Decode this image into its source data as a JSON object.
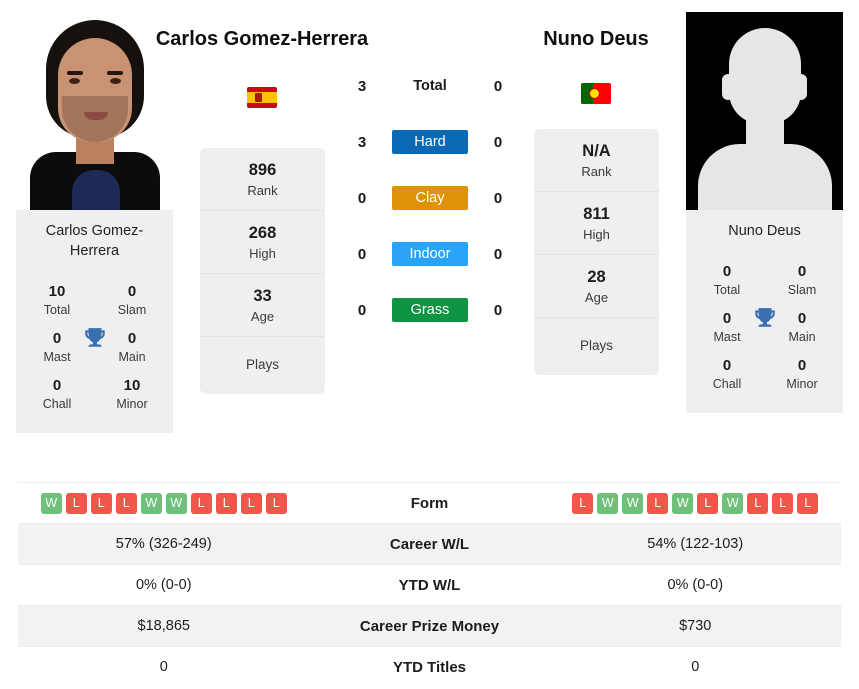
{
  "players": {
    "left": {
      "name": "Carlos Gomez-Herrera",
      "flag": "spain-flag",
      "photo": "player-headshot",
      "card_name": "Carlos Gomez-Herrera",
      "rank": "896",
      "rank_label": "Rank",
      "high": "268",
      "high_label": "High",
      "age": "33",
      "age_label": "Age",
      "plays_label": "Plays",
      "plays_value": "",
      "titles": {
        "total": "10",
        "total_label": "Total",
        "slam": "0",
        "slam_label": "Slam",
        "mast": "0",
        "mast_label": "Mast",
        "main": "0",
        "main_label": "Main",
        "chall": "0",
        "chall_label": "Chall",
        "minor": "10",
        "minor_label": "Minor"
      },
      "form": [
        "W",
        "L",
        "L",
        "L",
        "W",
        "W",
        "L",
        "L",
        "L",
        "L"
      ],
      "career_wl": "57% (326-249)",
      "ytd_wl": "0% (0-0)",
      "career_prize_money": "$18,865",
      "ytd_titles": "0"
    },
    "right": {
      "name": "Nuno Deus",
      "flag": "portugal-flag",
      "photo": "placeholder-avatar",
      "card_name": "Nuno Deus",
      "rank": "N/A",
      "rank_label": "Rank",
      "high": "811",
      "high_label": "High",
      "age": "28",
      "age_label": "Age",
      "plays_label": "Plays",
      "plays_value": "",
      "titles": {
        "total": "0",
        "total_label": "Total",
        "slam": "0",
        "slam_label": "Slam",
        "mast": "0",
        "mast_label": "Mast",
        "main": "0",
        "main_label": "Main",
        "chall": "0",
        "chall_label": "Chall",
        "minor": "0",
        "minor_label": "Minor"
      },
      "form": [
        "L",
        "W",
        "W",
        "L",
        "W",
        "L",
        "W",
        "L",
        "L",
        "L"
      ],
      "career_wl": "54% (122-103)",
      "ytd_wl": "0% (0-0)",
      "career_prize_money": "$730",
      "ytd_titles": "0"
    }
  },
  "head_to_head": [
    {
      "label": "Total",
      "left": "3",
      "right": "0",
      "color": ""
    },
    {
      "label": "Hard",
      "left": "3",
      "right": "0",
      "color": "#0b69b4"
    },
    {
      "label": "Clay",
      "left": "0",
      "right": "0",
      "color": "#dd9303"
    },
    {
      "label": "Indoor",
      "left": "0",
      "right": "0",
      "color": "#29a3f5"
    },
    {
      "label": "Grass",
      "left": "0",
      "right": "0",
      "color": "#0e9442"
    }
  ],
  "table_rows": [
    {
      "label": "Form"
    },
    {
      "label": "Career W/L"
    },
    {
      "label": "YTD W/L"
    },
    {
      "label": "Career Prize Money"
    },
    {
      "label": "YTD Titles"
    }
  ],
  "colors": {
    "win": "#6fc07a",
    "loss": "#f0574a",
    "hard": "#0b69b4",
    "clay": "#dd9303",
    "indoor": "#29a3f5",
    "grass": "#0e9442",
    "trophy": "#3b6fb0",
    "panel": "#efefef"
  }
}
